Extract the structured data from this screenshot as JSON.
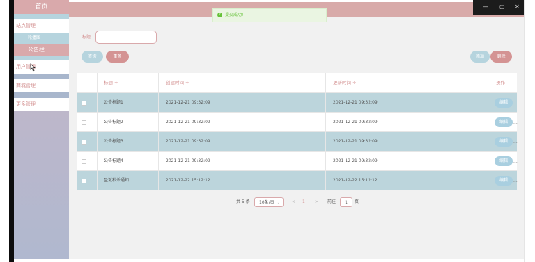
{
  "sidebar": {
    "home": "首页",
    "items": [
      {
        "label": "站点管理"
      },
      {
        "label": "轮播图"
      },
      {
        "label": "公告栏"
      },
      {
        "label": "用户管理"
      },
      {
        "label": "商城管理"
      },
      {
        "label": "更多管理"
      }
    ]
  },
  "toast": {
    "message": "提交成功!"
  },
  "window": {
    "minimize": "—",
    "maximize": "▢",
    "close": "✕"
  },
  "search": {
    "label": "标题",
    "value": ""
  },
  "buttons": {
    "query": "查询",
    "reset": "重置",
    "add": "添加",
    "delete": "删除"
  },
  "table": {
    "headers": {
      "title": "标题 ≑",
      "created": "创建时间 ≑",
      "updated": "更新时间 ≑",
      "ops": "操作"
    },
    "rows": [
      {
        "title": "公告标题1",
        "created": "2021-12-21 09:32:09",
        "updated": "2021-12-21 09:32:09",
        "edit": "编辑",
        "more": "..."
      },
      {
        "title": "公告标题2",
        "created": "2021-12-21 09:32:09",
        "updated": "2021-12-21 09:32:09",
        "edit": "编辑",
        "more": "..."
      },
      {
        "title": "公告标题3",
        "created": "2021-12-21 09:32:09",
        "updated": "2021-12-21 09:32:09",
        "edit": "编辑",
        "more": "..."
      },
      {
        "title": "公告标题4",
        "created": "2021-12-21 09:32:09",
        "updated": "2021-12-21 09:32:09",
        "edit": "编辑",
        "more": "..."
      },
      {
        "title": "圣诞秒杀通知",
        "created": "2021-12-22 15:12:12",
        "updated": "2021-12-22 15:12:12",
        "edit": "编辑",
        "more": "..."
      }
    ]
  },
  "pagination": {
    "total": "共 5 条",
    "page_size": "10条/页",
    "dropdown": "⌄",
    "prev": "<",
    "current": "1",
    "next": ">",
    "goto_label": "前往",
    "goto_value": "1",
    "goto_suffix": "页"
  },
  "colors": {
    "accent_pink": "#d49393",
    "accent_blue": "#b6d4de",
    "header_bg": "#d8aaa9",
    "toast_green": "#67c23a"
  }
}
